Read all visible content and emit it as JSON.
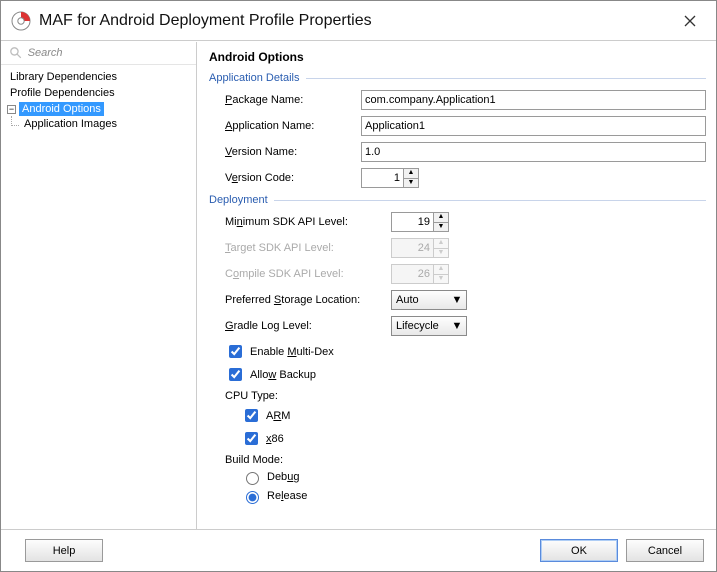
{
  "window": {
    "title": "MAF for Android Deployment Profile Properties"
  },
  "search": {
    "placeholder": "Search"
  },
  "tree": {
    "items": [
      {
        "label": "Library Dependencies"
      },
      {
        "label": "Profile Dependencies"
      },
      {
        "label": "Android Options",
        "selected": true,
        "expanded": true,
        "children": [
          {
            "label": "Application Images"
          }
        ]
      }
    ]
  },
  "panel": {
    "title": "Android Options",
    "section_app": "Application Details",
    "section_deploy": "Deployment",
    "labels": {
      "package_name": "Package Name:",
      "application_name": "Application Name:",
      "version_name": "Version Name:",
      "version_code": "Version Code:",
      "min_sdk": "Minimum SDK API Level:",
      "target_sdk": "Target SDK API Level:",
      "compile_sdk": "Compile SDK API Level:",
      "storage": "Preferred Storage Location:",
      "gradle": "Gradle Log Level:",
      "multidex": "Enable Multi-Dex",
      "allow_backup": "Allow Backup",
      "cpu_type": "CPU Type:",
      "cpu_arm": "ARM",
      "cpu_x86": "x86",
      "build_mode": "Build Mode:",
      "debug": "Debug",
      "release": "Release"
    },
    "values": {
      "package_name": "com.company.Application1",
      "application_name": "Application1",
      "version_name": "1.0",
      "version_code": "1",
      "min_sdk": "19",
      "target_sdk": "24",
      "compile_sdk": "26",
      "storage": "Auto",
      "gradle": "Lifecycle",
      "multidex": true,
      "allow_backup": true,
      "cpu_arm": true,
      "cpu_x86": true,
      "build_mode": "release"
    }
  },
  "footer": {
    "help": "Help",
    "ok": "OK",
    "cancel": "Cancel"
  }
}
